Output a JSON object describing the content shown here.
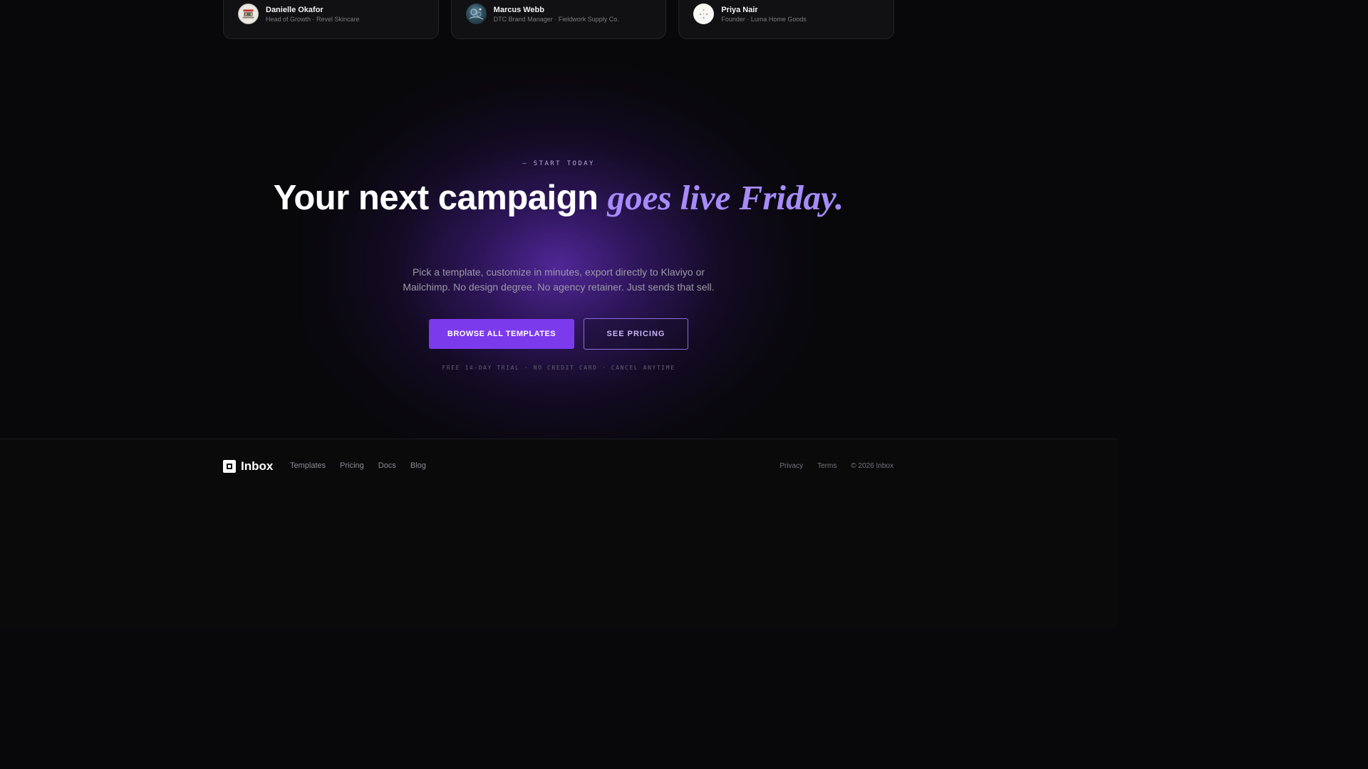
{
  "testimonials": [
    {
      "name": "Danielle Okafor",
      "role": "Head of Growth · Revel Skincare",
      "avatar_icon": "avatar-photo"
    },
    {
      "name": "Marcus Webb",
      "role": "DTC Brand Manager · Fieldwork Supply Co.",
      "avatar_icon": "avatar-photo"
    },
    {
      "name": "Priya Nair",
      "role": "Founder · Luma Home Goods",
      "avatar_icon": "avatar-photo"
    }
  ],
  "hero": {
    "eyebrow": "— START TODAY",
    "headline_plain": "Your next campaign ",
    "headline_accent": "goes live Friday.",
    "subtext": "Pick a template, customize in minutes, export directly to Klaviyo or Mailchimp. No design degree. No agency retainer. Just sends that sell.",
    "primary_cta": "BROWSE ALL TEMPLATES",
    "secondary_cta": "SEE PRICING",
    "fineprint": "FREE 14-DAY TRIAL · NO CREDIT CARD · CANCEL ANYTIME"
  },
  "footer": {
    "brand": "Inbox",
    "nav": [
      "Templates",
      "Pricing",
      "Docs",
      "Blog"
    ],
    "legal": [
      "Privacy",
      "Terms"
    ],
    "copyright": "© 2026 Inbox"
  },
  "colors": {
    "accent": "#7c3aed",
    "accent_text": "#a78bfa",
    "background": "#08080a"
  }
}
